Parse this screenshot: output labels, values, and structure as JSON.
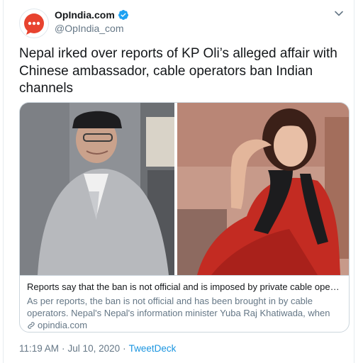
{
  "account": {
    "name": "OpIndia.com",
    "handle": "@OpIndia_com",
    "avatar_icon": "opindia-logo",
    "verified_icon": "verified-badge-icon",
    "verified_color": "#1da1f2",
    "brand_color": "#e8432f"
  },
  "tweet": {
    "text": "Nepal irked over reports of KP Oli’s alleged affair with Chinese ambassador, cable operators ban Indian channels"
  },
  "card": {
    "title": "Reports say that the ban is not official and is imposed by private cable operat…",
    "description": "As per reports, the ban is not official and has been brought in by cable operators. Nepal's Nepal's information minister Yuba Raj Khatiwada, when …",
    "domain": "opindia.com",
    "domain_icon": "link-icon"
  },
  "meta": {
    "time": "11:19 AM",
    "separator": "·",
    "date": "Jul 10, 2020",
    "separator2": "·",
    "source": "TweetDeck"
  },
  "colors": {
    "text_primary": "#14171a",
    "text_secondary": "#657786",
    "link": "#1b95e0",
    "border": "#ccd6dd"
  }
}
